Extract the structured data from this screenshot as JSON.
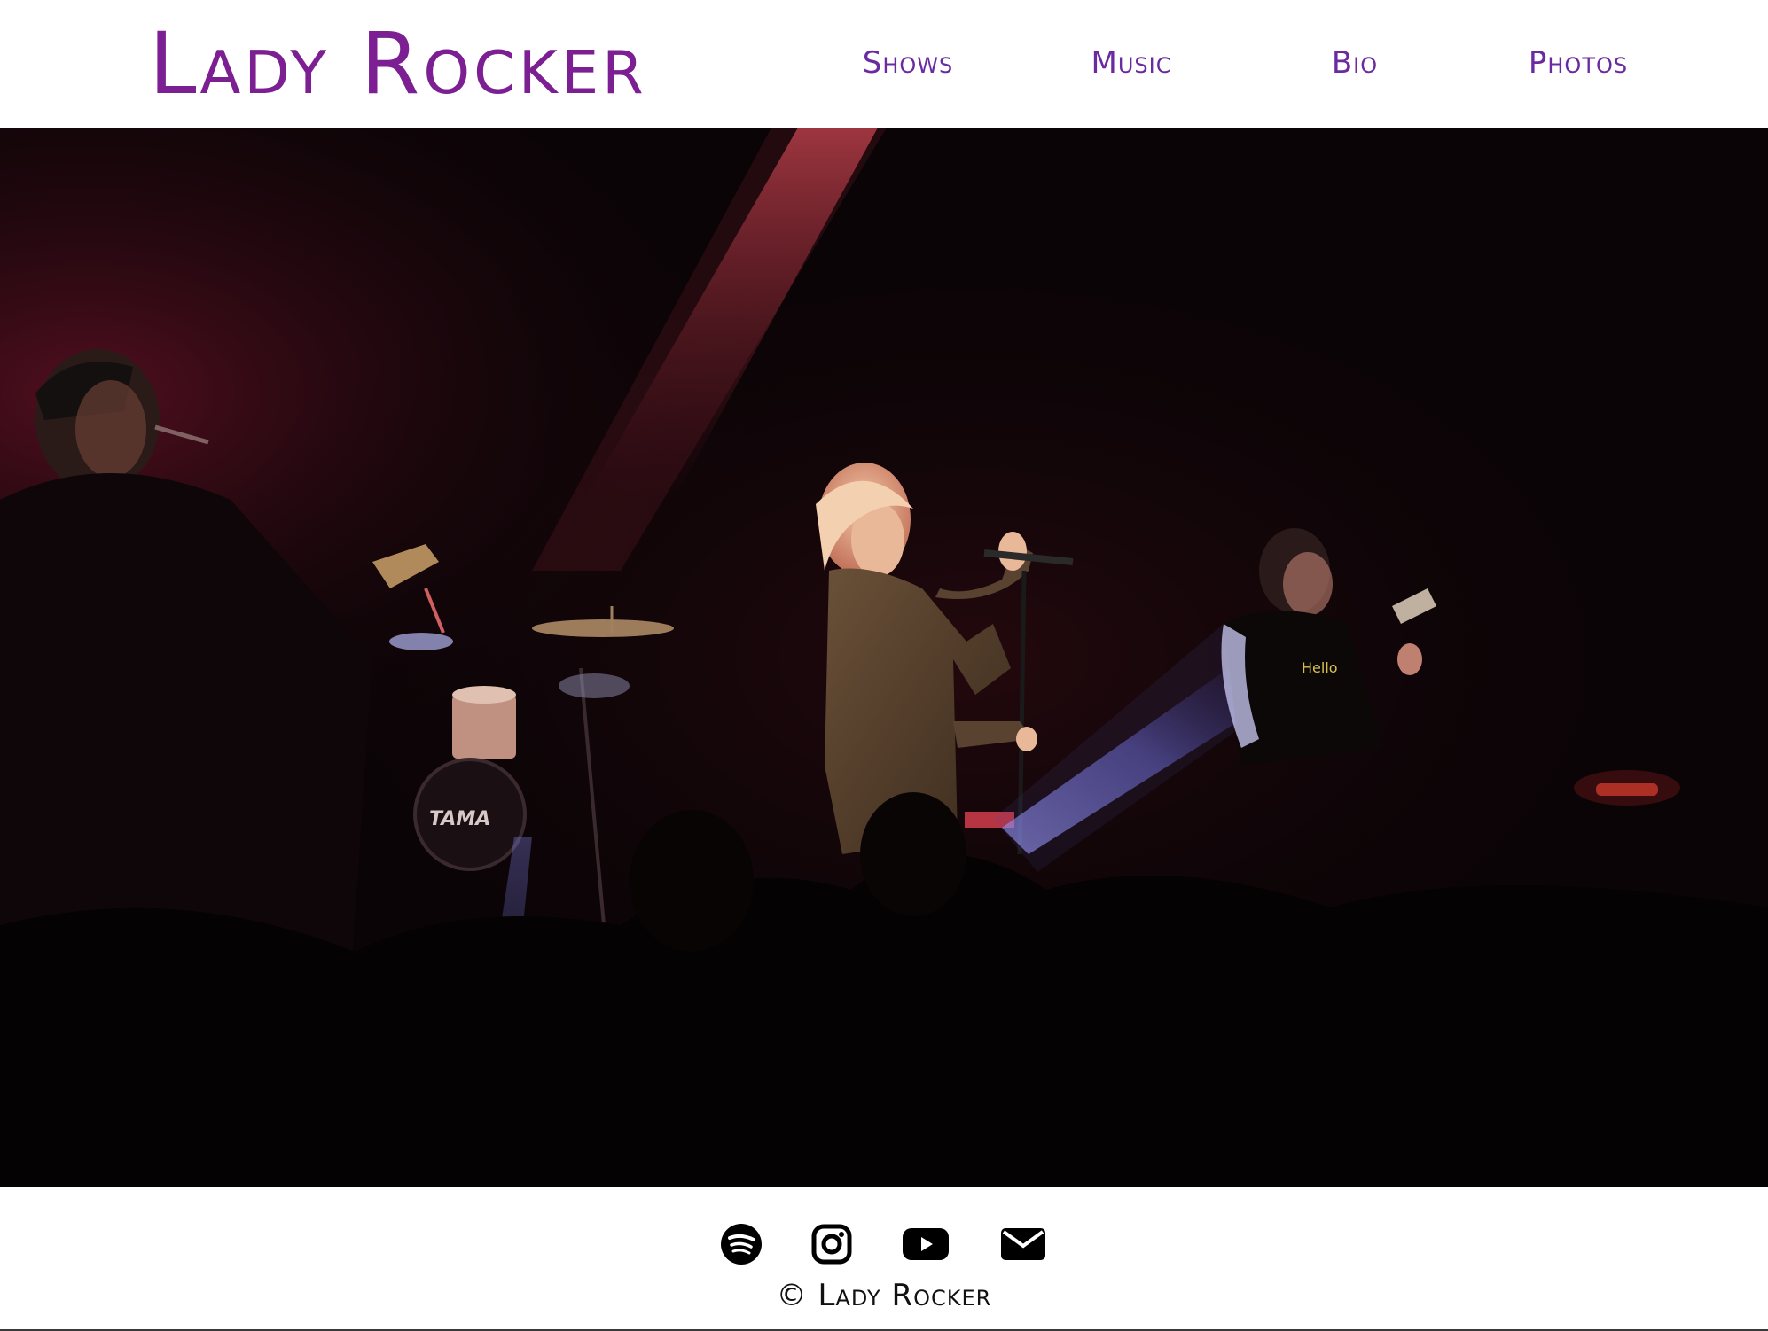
{
  "colors": {
    "brand": "#7b1f93",
    "nav": "#6a2ba0",
    "hero_bg": "#0a0406",
    "footer_text": "#111111"
  },
  "header": {
    "logo": "Lady Rocker",
    "nav": [
      {
        "label": "Shows"
      },
      {
        "label": "Music"
      },
      {
        "label": "Bio"
      },
      {
        "label": "Photos"
      }
    ]
  },
  "hero": {
    "image_icon": "concert-stage-photo"
  },
  "footer": {
    "social": [
      {
        "icon": "spotify-icon"
      },
      {
        "icon": "instagram-icon"
      },
      {
        "icon": "youtube-icon"
      },
      {
        "icon": "email-icon"
      }
    ],
    "copyright": "© Lady Rocker"
  }
}
